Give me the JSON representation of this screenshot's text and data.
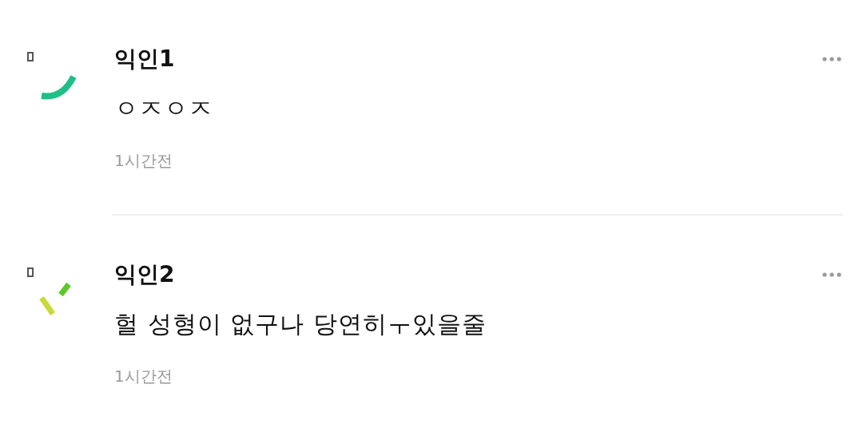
{
  "comments": [
    {
      "author": "익인1",
      "avatar": {
        "kind": "arc"
      },
      "text": "ㅇㅈㅇㅈ",
      "time": "1시간전"
    },
    {
      "author": "익인2",
      "avatar": {
        "kind": "dashes"
      },
      "text": "헐 성형이 없구나 당연히ㅜ있을줄",
      "time": "1시간전"
    }
  ]
}
